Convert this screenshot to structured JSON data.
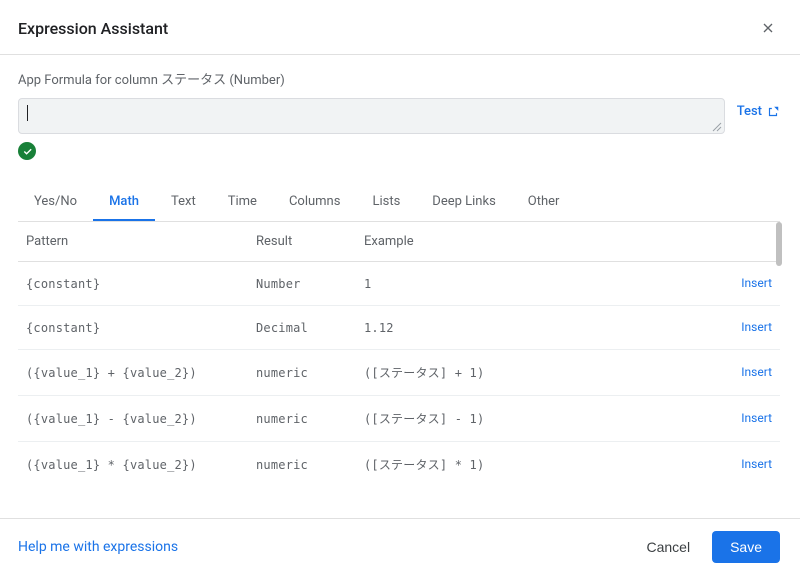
{
  "header": {
    "title": "Expression Assistant"
  },
  "formula": {
    "label": "App Formula for column ステータス (Number)",
    "value": "",
    "test_label": "Test",
    "valid": true
  },
  "tabs": [
    {
      "id": "yesno",
      "label": "Yes/No",
      "active": false
    },
    {
      "id": "math",
      "label": "Math",
      "active": true
    },
    {
      "id": "text",
      "label": "Text",
      "active": false
    },
    {
      "id": "time",
      "label": "Time",
      "active": false
    },
    {
      "id": "columns",
      "label": "Columns",
      "active": false
    },
    {
      "id": "lists",
      "label": "Lists",
      "active": false
    },
    {
      "id": "deeplinks",
      "label": "Deep Links",
      "active": false
    },
    {
      "id": "other",
      "label": "Other",
      "active": false
    }
  ],
  "table": {
    "headers": {
      "pattern": "Pattern",
      "result": "Result",
      "example": "Example"
    },
    "insert_label": "Insert",
    "rows": [
      {
        "pattern": "{constant}",
        "result": "Number",
        "example": "1"
      },
      {
        "pattern": "{constant}",
        "result": "Decimal",
        "example": "1.12"
      },
      {
        "pattern": "({value_1} + {value_2})",
        "result": "numeric",
        "example": "([ステータス] + 1)"
      },
      {
        "pattern": "({value_1} - {value_2})",
        "result": "numeric",
        "example": "([ステータス] - 1)"
      },
      {
        "pattern": "({value_1} * {value_2})",
        "result": "numeric",
        "example": "([ステータス] * 1)"
      }
    ]
  },
  "footer": {
    "help": "Help me with expressions",
    "cancel": "Cancel",
    "save": "Save"
  }
}
